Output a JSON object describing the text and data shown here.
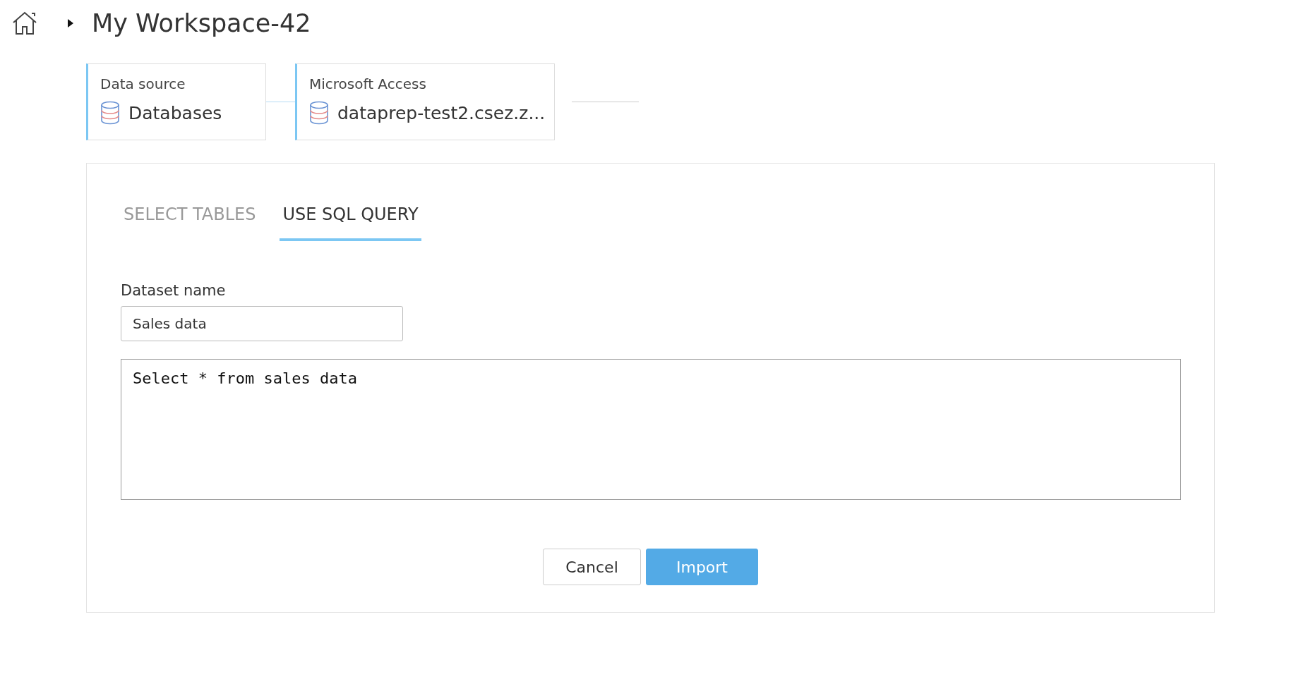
{
  "breadcrumb": {
    "title": "My Workspace-42"
  },
  "steps": [
    {
      "label": "Data source",
      "value": "Databases"
    },
    {
      "label": "Microsoft Access",
      "value": "dataprep-test2.csez.z..."
    }
  ],
  "tabs": [
    {
      "label": "SELECT TABLES",
      "selected": false
    },
    {
      "label": "USE SQL QUERY",
      "selected": true
    }
  ],
  "dataset_name": {
    "label": "Dataset name",
    "value": "Sales data"
  },
  "query": {
    "value": "Select * from sales data"
  },
  "buttons": [
    {
      "label": "Cancel",
      "kind": "secondary"
    },
    {
      "label": "Import",
      "kind": "primary"
    }
  ]
}
